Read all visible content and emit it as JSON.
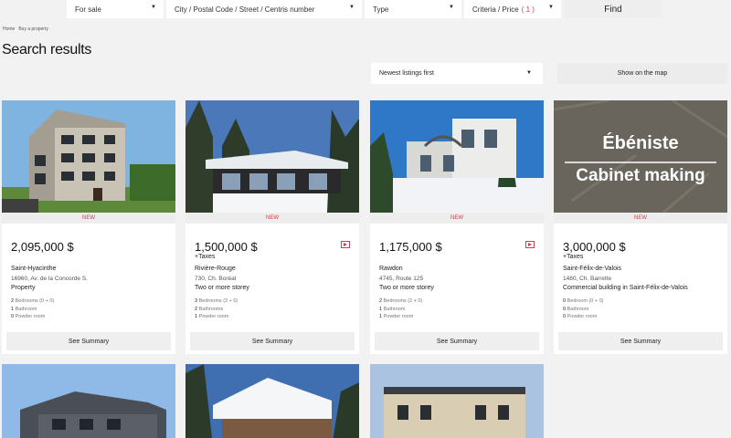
{
  "search": {
    "sale": "For sale",
    "city_placeholder": "City / Postal Code / Street / Centris number",
    "type": "Type",
    "criteria": "Criteria / Price",
    "criteria_count": "( 1 )",
    "find": "Find"
  },
  "breadcrumb": [
    "Home",
    "Buy a property"
  ],
  "page_title": "Search results",
  "sort": "Newest listings first",
  "map_button": "Show on the map",
  "listings": [
    {
      "badge": "NEW",
      "price": "2,095,000 $",
      "taxes": "",
      "video": false,
      "city": "Saint-Hyacinthe",
      "address": "16960, Av. de la Concorde S.",
      "type": "Property",
      "bedrooms": "2",
      "bedrooms_label": "Bedrooms (0 + 0)",
      "bathrooms": "1",
      "bathrooms_label": "Bathroom",
      "powder": "0",
      "powder_label": "Powder room",
      "summary": "See Summary"
    },
    {
      "badge": "NEW",
      "price": "1,500,000 $",
      "taxes": "+Taxes",
      "video": true,
      "city": "Rivière-Rouge",
      "address": "730, Ch. Boréal",
      "type": "Two or more storey",
      "bedrooms": "3",
      "bedrooms_label": "Bedrooms (3 + 0)",
      "bathrooms": "2",
      "bathrooms_label": "Bathrooms",
      "powder": "1",
      "powder_label": "Powder room",
      "summary": "See Summary"
    },
    {
      "badge": "NEW",
      "price": "1,175,000 $",
      "taxes": "",
      "video": true,
      "city": "Rawdon",
      "address": "4745, Route 125",
      "type": "Two or more storey",
      "bedrooms": "2",
      "bedrooms_label": "Bedrooms (2 + 0)",
      "bathrooms": "1",
      "bathrooms_label": "Bathroom",
      "powder": "1",
      "powder_label": "Powder room",
      "summary": "See Summary"
    },
    {
      "badge": "NEW",
      "price": "3,000,000 $",
      "taxes": "+Taxes",
      "video": false,
      "city": "Saint-Félix-de-Valois",
      "address": "1480, Ch. Barrette",
      "type": "Commercial building in Saint-Félix-de-Valois",
      "bedrooms": "0",
      "bedrooms_label": "Bedroom (0 + 0)",
      "bathrooms": "0",
      "bathrooms_label": "Bathroom",
      "powder": "0",
      "powder_label": "Powder room",
      "summary": "See Summary",
      "photo_text_1": "Ébéniste",
      "photo_text_2": "Cabinet making"
    }
  ],
  "colors": {
    "accent": "#d43a4e"
  }
}
